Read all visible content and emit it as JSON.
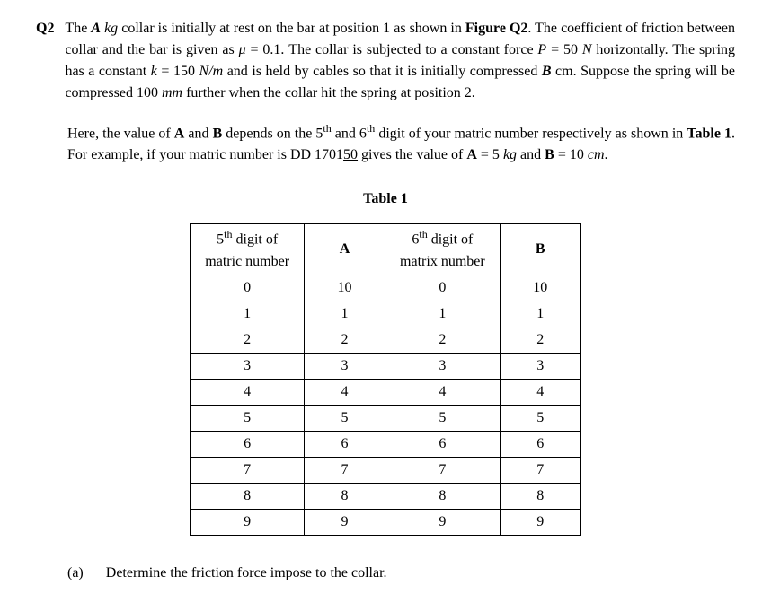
{
  "question": {
    "label": "Q2",
    "body": "The A kg collar is initially at rest on the bar at position 1 as shown in Figure Q2. The coefficient of friction between collar and the bar is given as μ = 0.1. The collar is subjected to a constant force P = 50 N horizontally. The spring has a constant k = 150 N/m and is held by cables so that it is initially compressed B cm. Suppose the spring will be compressed 100 mm further when the collar hit the spring at position 2.",
    "para2": "Here, the value of A and B depends on the 5th and 6th digit of your matric number respectively as shown in Table 1. For example, if your matric number is DD 170150 gives the value of A = 5 kg and B = 10 cm."
  },
  "table": {
    "title": "Table 1",
    "headers": {
      "col1_line1": "5",
      "col1_sup": "th",
      "col1_line2": " digit of",
      "col1_line3": "matric number",
      "col2": "A",
      "col3_line1": "6",
      "col3_sup": "th",
      "col3_line2": " digit of",
      "col3_line3": "matrix number",
      "col4": "B"
    },
    "rows": [
      {
        "d5": "0",
        "a": "10",
        "d6": "0",
        "b": "10"
      },
      {
        "d5": "1",
        "a": "1",
        "d6": "1",
        "b": "1"
      },
      {
        "d5": "2",
        "a": "2",
        "d6": "2",
        "b": "2"
      },
      {
        "d5": "3",
        "a": "3",
        "d6": "3",
        "b": "3"
      },
      {
        "d5": "4",
        "a": "4",
        "d6": "4",
        "b": "4"
      },
      {
        "d5": "5",
        "a": "5",
        "d6": "5",
        "b": "5"
      },
      {
        "d5": "6",
        "a": "6",
        "d6": "6",
        "b": "6"
      },
      {
        "d5": "7",
        "a": "7",
        "d6": "7",
        "b": "7"
      },
      {
        "d5": "8",
        "a": "8",
        "d6": "8",
        "b": "8"
      },
      {
        "d5": "9",
        "a": "9",
        "d6": "9",
        "b": "9"
      }
    ]
  },
  "subquestion": {
    "label": "(a)",
    "text": "Determine the friction force impose to the collar."
  },
  "text_parts": {
    "the": "The ",
    "a_var": "A",
    "kg_collar": " kg",
    "collar_rest": " collar is initially at rest on the bar at position 1 as shown in ",
    "figure_q2": "Figure Q2",
    "period_the": ". The coefficient of friction between collar and the bar is given as ",
    "mu": "μ",
    "eq_01": " = 0.1. The collar is subjected to a constant force ",
    "p_var": "P",
    "eq_50": " = 50 ",
    "n_unit": "N ",
    "horizontally": "horizontally. The spring has a constant ",
    "k_var": "k",
    "eq_150": " = 150 ",
    "nm_unit": "N/m",
    "held": " and is held by cables so that it is initially compressed ",
    "b_var": "B",
    "cm_suppose": " cm. Suppose the spring will be compressed 100 ",
    "mm_unit": "mm",
    "further": " further when the collar hit the spring at position 2.",
    "here_value": "Here, the value of ",
    "a_bold": "A",
    "and1": " and ",
    "b_bold": "B",
    "depends": " depends on the 5",
    "th1": "th",
    "and6": " and 6",
    "th2": "th",
    "digit_matric": " digit of your matric number respectively as shown in ",
    "table1_ref": "Table 1",
    "for_example": ". For example, if your matric number is DD 1701",
    "underline_50": "50",
    "gives": " gives the value of ",
    "a_eq": "A",
    "eq_5kg": " = 5 ",
    "kg_unit": "kg",
    "and2": " and ",
    "b_eq": "B",
    "eq_10": " = 10 ",
    "cm_unit": "cm",
    "period": "."
  }
}
